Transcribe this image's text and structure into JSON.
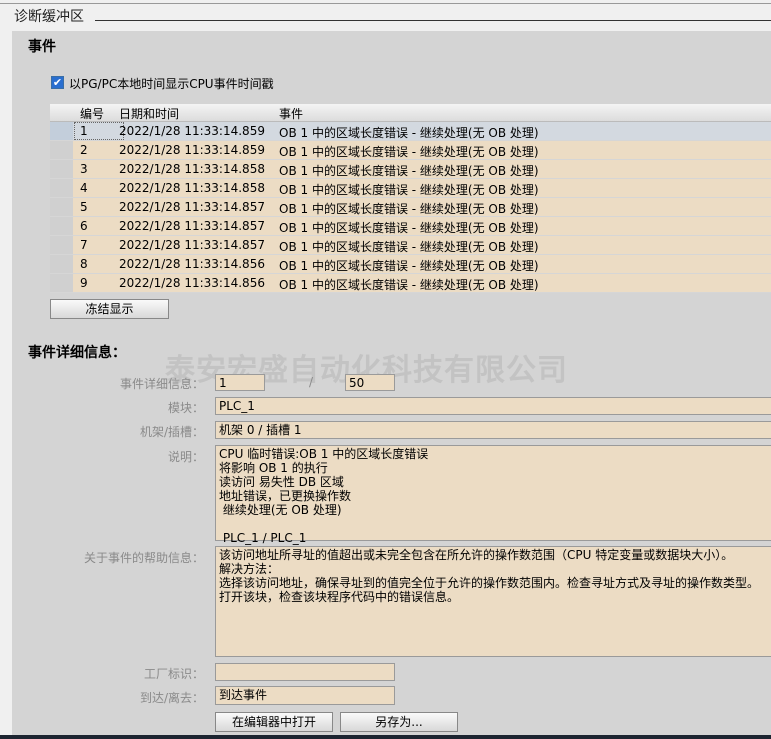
{
  "window_title": "诊断缓冲区",
  "events_section": {
    "title": "事件",
    "checkbox_label": "以PG/PC本地时间显示CPU事件时间戳",
    "checkbox_checked": true,
    "columns": [
      "编号",
      "日期和时间",
      "事件"
    ],
    "rows": [
      {
        "no": "1",
        "datetime": "2022/1/28 11:33:14.859",
        "event": "OB 1 中的区域长度错误 - 继续处理(无 OB 处理)"
      },
      {
        "no": "2",
        "datetime": "2022/1/28 11:33:14.859",
        "event": "OB 1 中的区域长度错误 - 继续处理(无 OB 处理)"
      },
      {
        "no": "3",
        "datetime": "2022/1/28 11:33:14.858",
        "event": "OB 1 中的区域长度错误 - 继续处理(无 OB 处理)"
      },
      {
        "no": "4",
        "datetime": "2022/1/28 11:33:14.858",
        "event": "OB 1 中的区域长度错误 - 继续处理(无 OB 处理)"
      },
      {
        "no": "5",
        "datetime": "2022/1/28 11:33:14.857",
        "event": "OB 1 中的区域长度错误 - 继续处理(无 OB 处理)"
      },
      {
        "no": "6",
        "datetime": "2022/1/28 11:33:14.857",
        "event": "OB 1 中的区域长度错误 - 继续处理(无 OB 处理)"
      },
      {
        "no": "7",
        "datetime": "2022/1/28 11:33:14.857",
        "event": "OB 1 中的区域长度错误 - 继续处理(无 OB 处理)"
      },
      {
        "no": "8",
        "datetime": "2022/1/28 11:33:14.856",
        "event": "OB 1 中的区域长度错误 - 继续处理(无 OB 处理)"
      },
      {
        "no": "9",
        "datetime": "2022/1/28 11:33:14.856",
        "event": "OB 1 中的区域长度错误 - 继续处理(无 OB 处理)"
      }
    ],
    "freeze_button": "冻结显示"
  },
  "details": {
    "title": "事件详细信息：",
    "watermark": "泰安宏盛自动化科技有限公司",
    "index_label": "事件详细信息：",
    "index_value": "1",
    "separator": "/",
    "total_value": "50",
    "module_label": "模块：",
    "module_value": "PLC_1",
    "rack_label": "机架/插槽：",
    "rack_value": "机架 0 / 插槽 1",
    "desc_label": "说明：",
    "desc_value": "CPU 临时错误:OB 1 中的区域长度错误\n将影响 OB 1 的执行\n读访问 易失性 DB 区域\n地址错误，已更换操作数\n 继续处理(无 OB 处理)\n\n PLC_1 / PLC_1",
    "help_label": "关于事件的帮助信息：",
    "help_value": "该访问地址所寻址的值超出或未完全包含在所允许的操作数范围（CPU 特定变量或数据块大小）。\n解决方法：\n选择该访问地址，确保寻址到的值完全位于允许的操作数范围内。检查寻址方式及寻址的操作数类型。\n打开该块，检查该块程序代码中的错误信息。",
    "plant_label": "工厂标识：",
    "plant_value": "",
    "arrive_label": "到达/离去：",
    "arrive_value": "到达事件",
    "open_editor_button": "在编辑器中打开",
    "save_as_button": "另存为..."
  }
}
